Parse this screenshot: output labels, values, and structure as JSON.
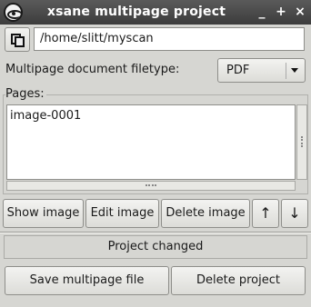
{
  "window": {
    "title": "xsane multipage project",
    "minimize_glyph": "_",
    "maximize_glyph": "+",
    "close_glyph": "×",
    "app_icon": "xsane-eye-icon"
  },
  "project": {
    "path": "/home/slitt/myscan",
    "copy_icon": "copy-icon"
  },
  "filetype": {
    "label": "Multipage document filetype:",
    "selected": "PDF"
  },
  "pages": {
    "label": "Pages:",
    "items": [
      "image-0001"
    ]
  },
  "actions": {
    "show_image": "Show image",
    "edit_image": "Edit image",
    "delete_image": "Delete image",
    "move_up": "↑",
    "move_down": "↓"
  },
  "status": {
    "text": "Project changed"
  },
  "footer": {
    "save": "Save multipage file",
    "delete_project": "Delete project"
  }
}
